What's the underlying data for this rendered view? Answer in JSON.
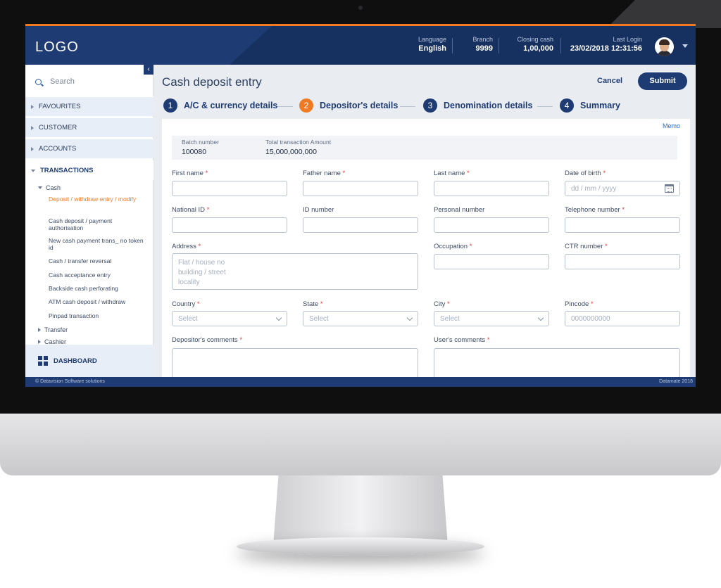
{
  "header": {
    "logo": "LOGO",
    "language_label": "Language",
    "language_value": "English",
    "branch_label": "Branch",
    "branch_value": "9999",
    "closing_label": "Closing cash",
    "closing_value": "1,00,000",
    "login_label": "Last Login",
    "login_value": "23/02/2018 12:31:56"
  },
  "sidebar": {
    "search_placeholder": "Search",
    "sections": [
      "FAVOURITES",
      "CUSTOMER",
      "ACCOUNTS",
      "TRANSACTIONS"
    ],
    "cash_label": "Cash",
    "items": [
      "Deposit / withdraw entry / modify",
      "Cash deposit / payment authorisation",
      "New cash payment trans_ no token id",
      "Cash / transfer reversal",
      "Cash acceptance entry",
      "Backside cash perforating",
      "ATM cash deposit / withdraw",
      "Pinpad transaction"
    ],
    "transfer_label": "Transfer",
    "cashier_label": "Cashier",
    "dashboard_label": "DASHBOARD"
  },
  "page": {
    "title": "Cash deposit entry",
    "cancel_label": "Cancel",
    "submit_label": "Submit",
    "steps": [
      {
        "num": "1",
        "label": "A/C & currency details"
      },
      {
        "num": "2",
        "label": "Depositor's details"
      },
      {
        "num": "3",
        "label": "Denomination details"
      },
      {
        "num": "4",
        "label": "Summary"
      }
    ],
    "memo_label": "Memo"
  },
  "batch": {
    "batch_label": "Batch number",
    "batch_value": "100080",
    "amount_label": "Total transaction Amount",
    "amount_value": "15,000,000,000"
  },
  "form": {
    "first_name": "First name",
    "father_name": "Father name",
    "last_name": "Last name",
    "dob": "Date of birth",
    "dob_placeholder": "dd / mm / yyyy",
    "national_id": "National ID",
    "id_number": "ID number",
    "personal_number": "Personal number",
    "telephone": "Telephone number",
    "address": "Address",
    "address_line1": "Flat / house no",
    "address_line2": "building / street",
    "address_line3": "locality",
    "occupation": "Occupation",
    "ctr": "CTR number",
    "country": "Country",
    "state": "State",
    "city": "City",
    "pincode": "Pincode",
    "select_placeholder": "Select",
    "pincode_placeholder": "0000000000",
    "depositor_comments": "Depositor's comments",
    "user_comments": "User's comments",
    "req": "*"
  },
  "footer": {
    "left": "© Datavision Software solutions",
    "right": "Datamate 2018"
  },
  "colors": {
    "brand": "#1e3c73",
    "accent": "#f07a22",
    "required": "#e23b3b"
  }
}
